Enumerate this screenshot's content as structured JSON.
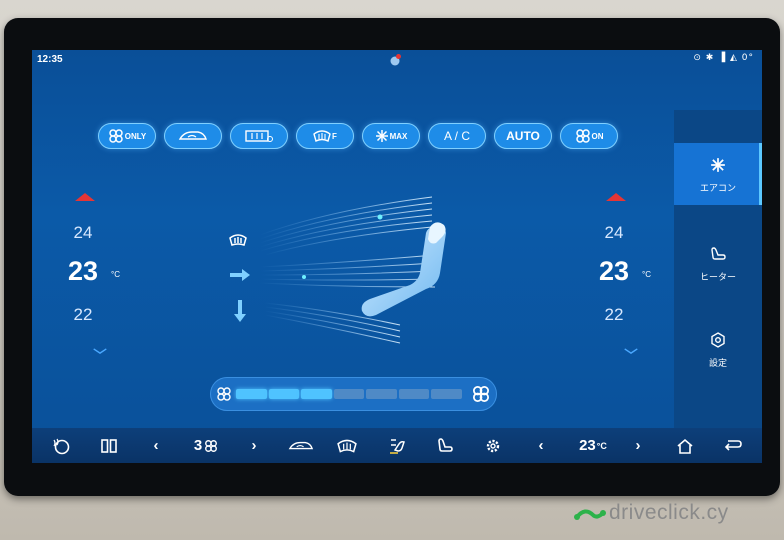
{
  "status_bar": {
    "time": "12:35",
    "right_icons": "⊙ ✱ ▐ ◭ 0°"
  },
  "modes": [
    {
      "id": "fan-only",
      "text": "ONLY"
    },
    {
      "id": "recirc",
      "text": ""
    },
    {
      "id": "rear-defrost",
      "text": ""
    },
    {
      "id": "front-defrost",
      "text": "F"
    },
    {
      "id": "max-ac",
      "text": "MAX"
    },
    {
      "id": "ac",
      "text": "A / C"
    },
    {
      "id": "auto",
      "text": "AUTO"
    },
    {
      "id": "fan-on",
      "text": "ON"
    }
  ],
  "left_temp": {
    "upper": "24",
    "current": "23",
    "lower": "22",
    "unit": "°C"
  },
  "right_temp": {
    "upper": "24",
    "current": "23",
    "lower": "22",
    "unit": "°C"
  },
  "fan_speed": {
    "level": 3,
    "max": 7
  },
  "side_tabs": [
    {
      "label": "エアコン",
      "icon": "snowflake-icon",
      "active": true
    },
    {
      "label": "ヒーター",
      "icon": "seat-heater-icon",
      "active": false
    },
    {
      "label": "設定",
      "icon": "settings-icon",
      "active": false
    }
  ],
  "bottom_bar": {
    "fan_value": "3",
    "temp_value": "23"
  },
  "watermark": {
    "brand": "driveclick.cy"
  },
  "colors": {
    "accent": "#1e8ce8",
    "glow": "#4fc3ff",
    "up_arrow": "#e53535",
    "down_arrow": "#4aa8ff"
  }
}
